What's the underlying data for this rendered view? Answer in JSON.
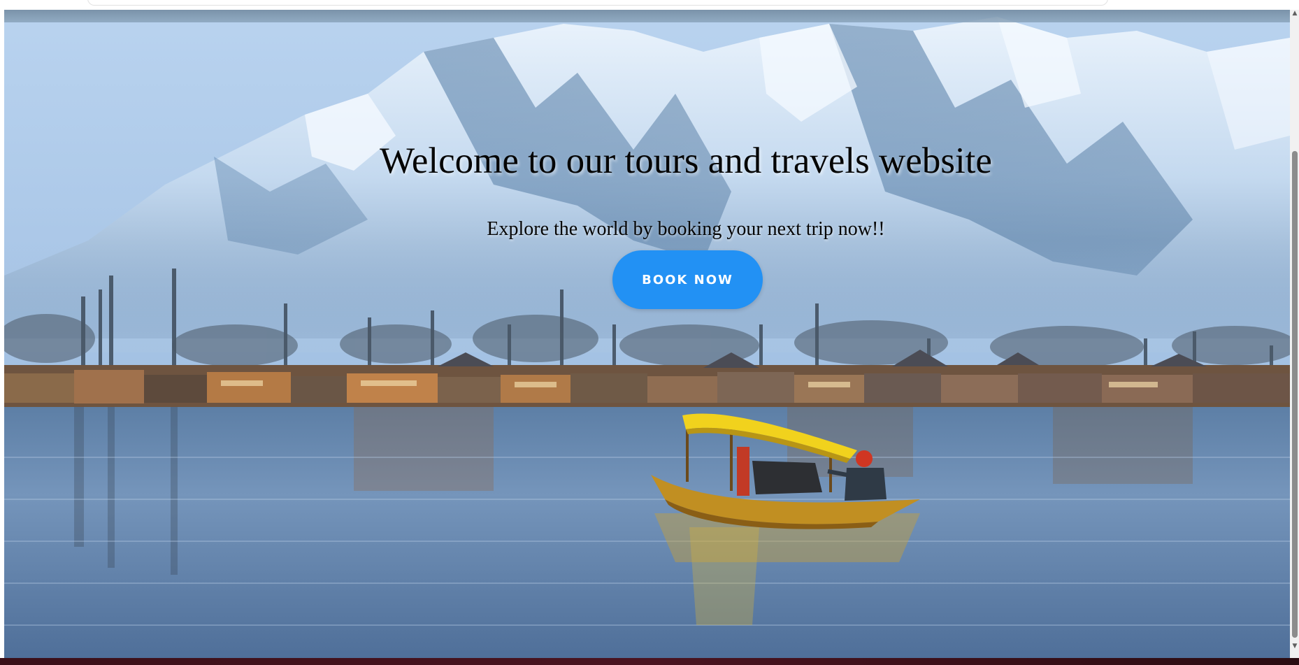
{
  "hero": {
    "title": "Welcome to our tours and travels website",
    "subtitle": "Explore the world by booking your next trip now!!",
    "button_label": "BOOK NOW",
    "background_scene": "snow-capped mountains above a lake with houseboats and a yellow shikara boat"
  },
  "colors": {
    "button": "#2291f4",
    "button_text": "#ffffff",
    "title_text": "#050505",
    "bottom_bar": "#3a1019"
  },
  "scrollbar": {
    "up_arrow": "▲",
    "down_arrow": "▼"
  }
}
